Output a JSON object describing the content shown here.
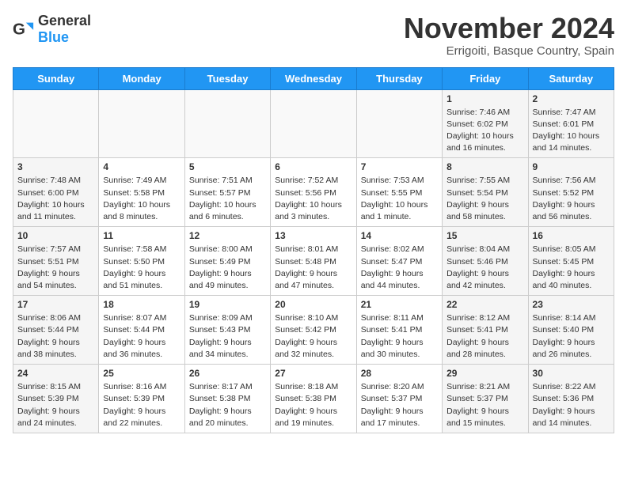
{
  "logo": {
    "text_general": "General",
    "text_blue": "Blue"
  },
  "header": {
    "month_year": "November 2024",
    "location": "Errigoiti, Basque Country, Spain"
  },
  "days_of_week": [
    "Sunday",
    "Monday",
    "Tuesday",
    "Wednesday",
    "Thursday",
    "Friday",
    "Saturday"
  ],
  "weeks": [
    [
      {
        "day": "",
        "type": "empty",
        "info": ""
      },
      {
        "day": "",
        "type": "empty",
        "info": ""
      },
      {
        "day": "",
        "type": "empty",
        "info": ""
      },
      {
        "day": "",
        "type": "empty",
        "info": ""
      },
      {
        "day": "",
        "type": "empty",
        "info": ""
      },
      {
        "day": "1",
        "type": "weekend",
        "info": "Sunrise: 7:46 AM\nSunset: 6:02 PM\nDaylight: 10 hours\nand 16 minutes."
      },
      {
        "day": "2",
        "type": "weekend",
        "info": "Sunrise: 7:47 AM\nSunset: 6:01 PM\nDaylight: 10 hours\nand 14 minutes."
      }
    ],
    [
      {
        "day": "3",
        "type": "weekend",
        "info": "Sunrise: 7:48 AM\nSunset: 6:00 PM\nDaylight: 10 hours\nand 11 minutes."
      },
      {
        "day": "4",
        "type": "weekday",
        "info": "Sunrise: 7:49 AM\nSunset: 5:58 PM\nDaylight: 10 hours\nand 8 minutes."
      },
      {
        "day": "5",
        "type": "weekday",
        "info": "Sunrise: 7:51 AM\nSunset: 5:57 PM\nDaylight: 10 hours\nand 6 minutes."
      },
      {
        "day": "6",
        "type": "weekday",
        "info": "Sunrise: 7:52 AM\nSunset: 5:56 PM\nDaylight: 10 hours\nand 3 minutes."
      },
      {
        "day": "7",
        "type": "weekday",
        "info": "Sunrise: 7:53 AM\nSunset: 5:55 PM\nDaylight: 10 hours\nand 1 minute."
      },
      {
        "day": "8",
        "type": "weekend",
        "info": "Sunrise: 7:55 AM\nSunset: 5:54 PM\nDaylight: 9 hours\nand 58 minutes."
      },
      {
        "day": "9",
        "type": "weekend",
        "info": "Sunrise: 7:56 AM\nSunset: 5:52 PM\nDaylight: 9 hours\nand 56 minutes."
      }
    ],
    [
      {
        "day": "10",
        "type": "weekend",
        "info": "Sunrise: 7:57 AM\nSunset: 5:51 PM\nDaylight: 9 hours\nand 54 minutes."
      },
      {
        "day": "11",
        "type": "weekday",
        "info": "Sunrise: 7:58 AM\nSunset: 5:50 PM\nDaylight: 9 hours\nand 51 minutes."
      },
      {
        "day": "12",
        "type": "weekday",
        "info": "Sunrise: 8:00 AM\nSunset: 5:49 PM\nDaylight: 9 hours\nand 49 minutes."
      },
      {
        "day": "13",
        "type": "weekday",
        "info": "Sunrise: 8:01 AM\nSunset: 5:48 PM\nDaylight: 9 hours\nand 47 minutes."
      },
      {
        "day": "14",
        "type": "weekday",
        "info": "Sunrise: 8:02 AM\nSunset: 5:47 PM\nDaylight: 9 hours\nand 44 minutes."
      },
      {
        "day": "15",
        "type": "weekend",
        "info": "Sunrise: 8:04 AM\nSunset: 5:46 PM\nDaylight: 9 hours\nand 42 minutes."
      },
      {
        "day": "16",
        "type": "weekend",
        "info": "Sunrise: 8:05 AM\nSunset: 5:45 PM\nDaylight: 9 hours\nand 40 minutes."
      }
    ],
    [
      {
        "day": "17",
        "type": "weekend",
        "info": "Sunrise: 8:06 AM\nSunset: 5:44 PM\nDaylight: 9 hours\nand 38 minutes."
      },
      {
        "day": "18",
        "type": "weekday",
        "info": "Sunrise: 8:07 AM\nSunset: 5:44 PM\nDaylight: 9 hours\nand 36 minutes."
      },
      {
        "day": "19",
        "type": "weekday",
        "info": "Sunrise: 8:09 AM\nSunset: 5:43 PM\nDaylight: 9 hours\nand 34 minutes."
      },
      {
        "day": "20",
        "type": "weekday",
        "info": "Sunrise: 8:10 AM\nSunset: 5:42 PM\nDaylight: 9 hours\nand 32 minutes."
      },
      {
        "day": "21",
        "type": "weekday",
        "info": "Sunrise: 8:11 AM\nSunset: 5:41 PM\nDaylight: 9 hours\nand 30 minutes."
      },
      {
        "day": "22",
        "type": "weekend",
        "info": "Sunrise: 8:12 AM\nSunset: 5:41 PM\nDaylight: 9 hours\nand 28 minutes."
      },
      {
        "day": "23",
        "type": "weekend",
        "info": "Sunrise: 8:14 AM\nSunset: 5:40 PM\nDaylight: 9 hours\nand 26 minutes."
      }
    ],
    [
      {
        "day": "24",
        "type": "weekend",
        "info": "Sunrise: 8:15 AM\nSunset: 5:39 PM\nDaylight: 9 hours\nand 24 minutes."
      },
      {
        "day": "25",
        "type": "weekday",
        "info": "Sunrise: 8:16 AM\nSunset: 5:39 PM\nDaylight: 9 hours\nand 22 minutes."
      },
      {
        "day": "26",
        "type": "weekday",
        "info": "Sunrise: 8:17 AM\nSunset: 5:38 PM\nDaylight: 9 hours\nand 20 minutes."
      },
      {
        "day": "27",
        "type": "weekday",
        "info": "Sunrise: 8:18 AM\nSunset: 5:38 PM\nDaylight: 9 hours\nand 19 minutes."
      },
      {
        "day": "28",
        "type": "weekday",
        "info": "Sunrise: 8:20 AM\nSunset: 5:37 PM\nDaylight: 9 hours\nand 17 minutes."
      },
      {
        "day": "29",
        "type": "weekend",
        "info": "Sunrise: 8:21 AM\nSunset: 5:37 PM\nDaylight: 9 hours\nand 15 minutes."
      },
      {
        "day": "30",
        "type": "weekend",
        "info": "Sunrise: 8:22 AM\nSunset: 5:36 PM\nDaylight: 9 hours\nand 14 minutes."
      }
    ]
  ]
}
